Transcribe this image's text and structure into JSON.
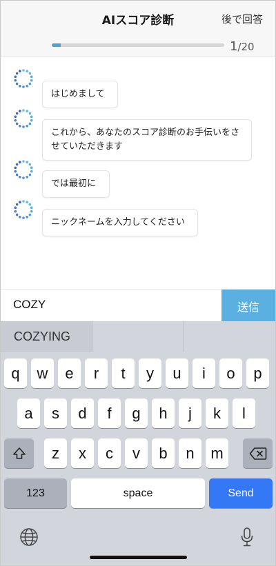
{
  "header": {
    "title": "AIスコア診断",
    "later_label": "後で回答",
    "progress": {
      "current": "1",
      "total": "/20",
      "fraction": 0.05
    }
  },
  "chat": {
    "messages": [
      {
        "text": "はじめまして"
      },
      {
        "text": "これから、あなたのスコア診断のお手伝いをさせていただきます"
      },
      {
        "text": "では最初に"
      },
      {
        "text": "ニックネームを入力してください"
      }
    ]
  },
  "input": {
    "value": "COZY",
    "send_label": "送信"
  },
  "keyboard": {
    "suggestions": [
      "COZYING",
      "",
      ""
    ],
    "row1": [
      "q",
      "w",
      "e",
      "r",
      "t",
      "y",
      "u",
      "i",
      "o",
      "p"
    ],
    "row2": [
      "a",
      "s",
      "d",
      "f",
      "g",
      "h",
      "j",
      "k",
      "l"
    ],
    "row3": [
      "z",
      "x",
      "c",
      "v",
      "b",
      "n",
      "m"
    ],
    "numbers_label": "123",
    "space_label": "space",
    "send_label": "Send"
  },
  "icons": {
    "shift": "shift-icon",
    "backspace": "backspace-icon",
    "globe": "globe-icon",
    "mic": "microphone-icon",
    "avatar": "bot-avatar-icon"
  },
  "colors": {
    "accent": "#5ab1e1",
    "progress": "#4aa3d6",
    "keyboard_send": "#3478f6"
  }
}
